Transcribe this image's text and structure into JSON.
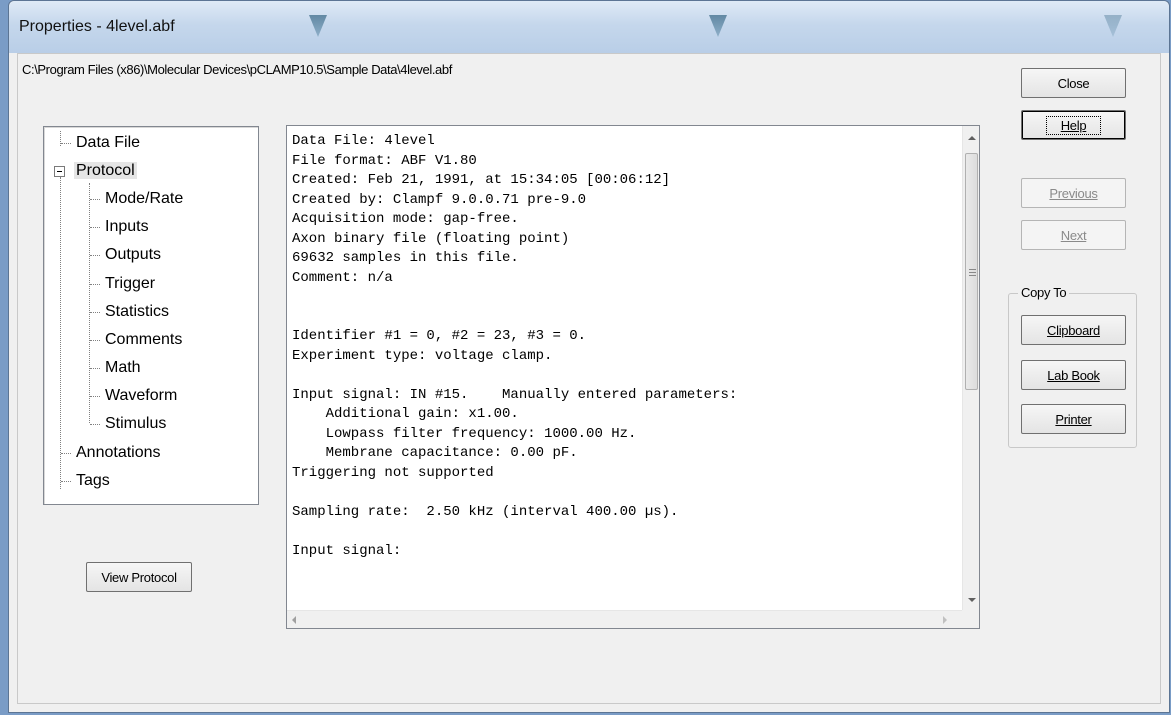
{
  "window": {
    "title": "Properties - 4level.abf",
    "file_path": "C:\\Program Files (x86)\\Molecular Devices\\pCLAMP10.5\\Sample Data\\4level.abf"
  },
  "tree": {
    "items": [
      {
        "label": "Data File"
      },
      {
        "label": "Protocol"
      },
      {
        "label": "Mode/Rate"
      },
      {
        "label": "Inputs"
      },
      {
        "label": "Outputs"
      },
      {
        "label": "Trigger"
      },
      {
        "label": "Statistics"
      },
      {
        "label": "Comments"
      },
      {
        "label": "Math"
      },
      {
        "label": "Waveform"
      },
      {
        "label": "Stimulus"
      },
      {
        "label": "Annotations"
      },
      {
        "label": "Tags"
      }
    ],
    "selected": "Protocol"
  },
  "buttons": {
    "view_protocol": "View Protocol",
    "close": "Close",
    "help": "Help",
    "previous": "Previous",
    "next": "Next",
    "clipboard": "Clipboard",
    "lab_book": "Lab Book",
    "printer": "Printer"
  },
  "copy_to": {
    "label": "Copy To"
  },
  "details": {
    "lines": [
      "Data File: 4level",
      "File format: ABF V1.80",
      "Created: Feb 21, 1991, at 15:34:05 [00:06:12]",
      "Created by: Clampf 9.0.0.71 pre-9.0",
      "Acquisition mode: gap-free.",
      "Axon binary file (floating point)",
      "69632 samples in this file.",
      "Comment: n/a",
      "",
      "",
      "Identifier #1 = 0, #2 = 23, #3 = 0.",
      "Experiment type: voltage clamp.",
      "",
      "Input signal: IN #15.    Manually entered parameters:",
      "    Additional gain: x1.00.",
      "    Lowpass filter frequency: 1000.00 Hz.",
      "    Membrane capacitance: 0.00 pF.",
      "Triggering not supported",
      "",
      "Sampling rate:  2.50 kHz (interval 400.00 µs).",
      "",
      "Input signal:"
    ]
  }
}
